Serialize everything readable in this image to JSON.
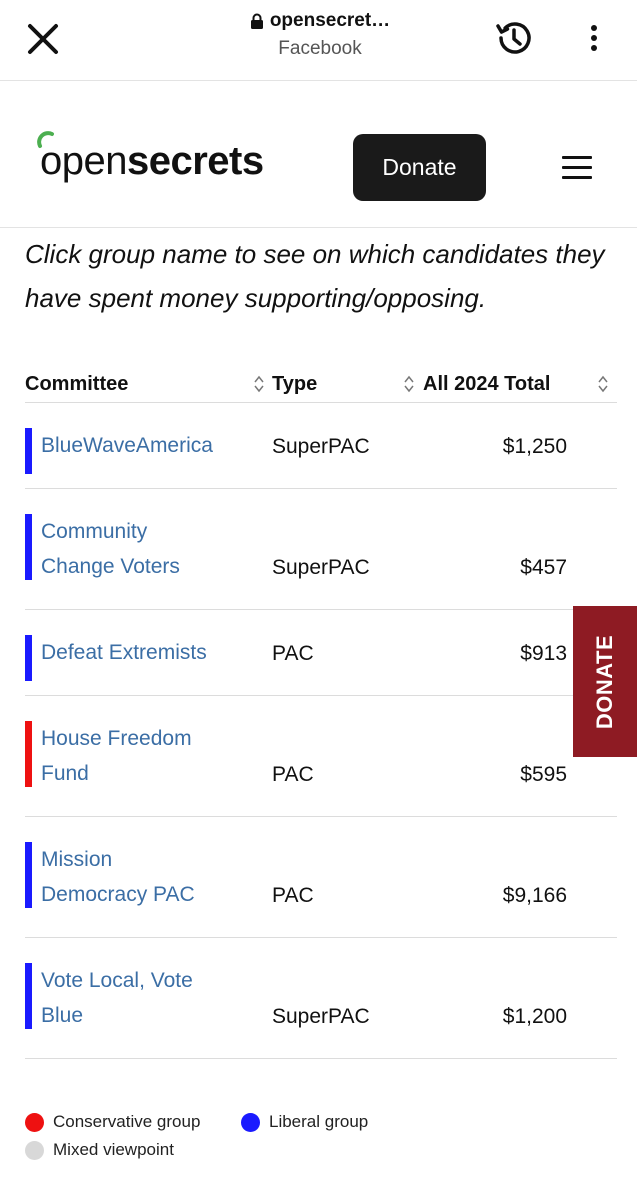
{
  "browser": {
    "url": "opensecret…",
    "source": "Facebook"
  },
  "site": {
    "logo_open": "open",
    "logo_secrets": "secrets",
    "donate_label": "Donate",
    "side_donate_label": "DONATE"
  },
  "intro": "Click group name to see on which candidates they have spent money supporting/opposing.",
  "table": {
    "headers": {
      "committee": "Committee",
      "type": "Type",
      "total": "All 2024 Total"
    },
    "rows": [
      {
        "name_line1": "BlueWaveAmerica",
        "name_line2": "",
        "type": "SuperPAC",
        "total": "$1,250",
        "color": "#1a1aff"
      },
      {
        "name_line1": "Community",
        "name_line2": "Change Voters",
        "type": "SuperPAC",
        "total": "$457",
        "color": "#1a1aff"
      },
      {
        "name_line1": "Defeat Extremists",
        "name_line2": "",
        "type": "PAC",
        "total": "$913",
        "color": "#1a1aff"
      },
      {
        "name_line1": "House Freedom",
        "name_line2": "Fund",
        "type": "PAC",
        "total": "$595",
        "color": "#ee1111"
      },
      {
        "name_line1": "Mission",
        "name_line2": "Democracy PAC",
        "type": "PAC",
        "total": "$9,166",
        "color": "#1a1aff"
      },
      {
        "name_line1": "Vote Local, Vote",
        "name_line2": "Blue",
        "type": "SuperPAC",
        "total": "$1,200",
        "color": "#1a1aff"
      }
    ]
  },
  "legend": {
    "conservative": {
      "label": "Conservative group",
      "color": "#ee1111"
    },
    "liberal": {
      "label": "Liberal group",
      "color": "#1a1aff"
    },
    "mixed": {
      "label": "Mixed viewpoint",
      "color": "#d8d8d8"
    }
  },
  "colors": {
    "link": "#3b6ea5",
    "side_donate_bg": "#8e1b23",
    "donate_bg": "#1a1a1a"
  }
}
